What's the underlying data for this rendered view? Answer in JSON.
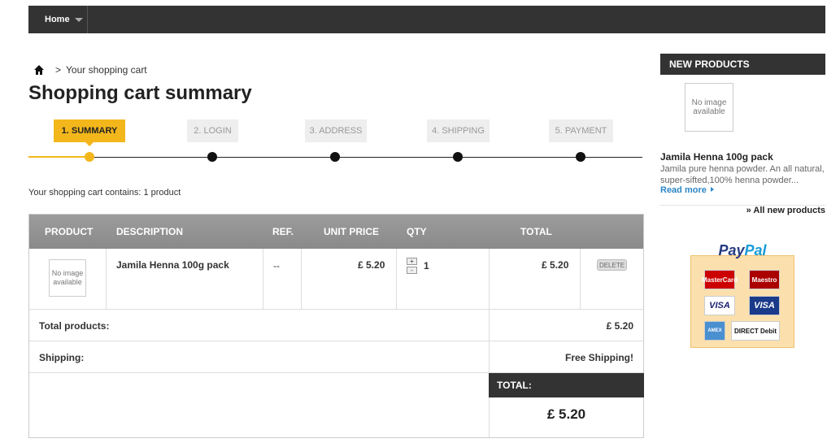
{
  "nav": {
    "home_label": "Home"
  },
  "breadcrumb": {
    "separator": ">",
    "current": "Your shopping cart"
  },
  "page_title": "Shopping cart summary",
  "steps": [
    {
      "label": "1. SUMMARY"
    },
    {
      "label": "2. LOGIN"
    },
    {
      "label": "3. ADDRESS"
    },
    {
      "label": "4. SHIPPING"
    },
    {
      "label": "5. PAYMENT"
    }
  ],
  "cart_count_text": "Your shopping cart contains: 1 product",
  "table": {
    "headers": {
      "product": "PRODUCT",
      "description": "DESCRIPTION",
      "ref": "REF.",
      "unit_price": "UNIT PRICE",
      "qty": "QTY",
      "total": "TOTAL"
    },
    "item": {
      "image_text": "No image available",
      "description": "Jamila Henna 100g pack",
      "ref": "--",
      "unit_price": "£ 5.20",
      "qty": "1",
      "qty_plus": "+",
      "qty_minus": "-",
      "total": "£ 5.20",
      "delete_label": "DELETE"
    },
    "total_products_label": "Total products:",
    "total_products_value": "£ 5.20",
    "shipping_label": "Shipping:",
    "shipping_value": "Free Shipping!",
    "total_label": "TOTAL:",
    "total_value": "£ 5.20"
  },
  "sidebar": {
    "new_products_title": "NEW PRODUCTS",
    "image_text": "No image available",
    "product_name": "Jamila Henna 100g pack",
    "product_desc": "Jamila pure henna powder. An all natural, super-sifted,100% henna powder...",
    "read_more": "Read more",
    "all_new": "» All new products"
  },
  "paypal": {
    "logo_part1": "Pay",
    "logo_part2": "Pal",
    "cards": [
      "MasterCard",
      "Maestro",
      "VISA",
      "VISA",
      "AMEX",
      "DIRECT Debit"
    ]
  },
  "colors": {
    "accent": "#f3b71c",
    "dark": "#333333",
    "link": "#2a86c7"
  }
}
